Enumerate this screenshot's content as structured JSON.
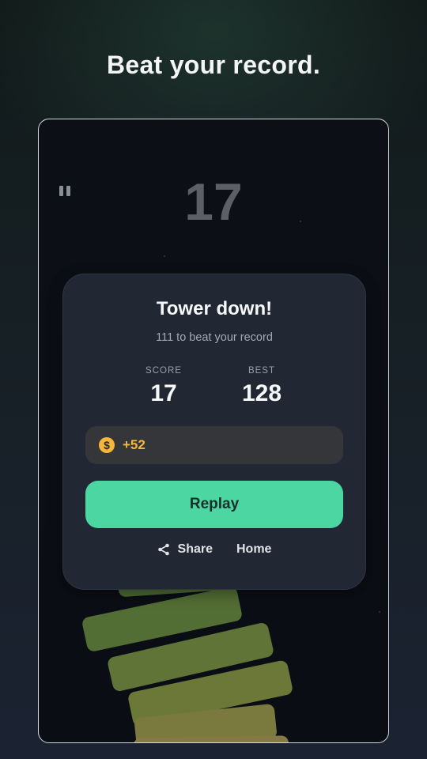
{
  "headline": "Beat your record.",
  "game": {
    "current_score": "17",
    "pause_icon": "pause-icon"
  },
  "dialog": {
    "title": "Tower down!",
    "subtitle": "111 to beat your record",
    "score_label": "SCORE",
    "score_value": "17",
    "best_label": "BEST",
    "best_value": "128",
    "coin_icon": "dollar-coin-icon",
    "coins_earned": "+52",
    "replay_label": "Replay",
    "share_label": "Share",
    "share_icon": "share-icon",
    "home_label": "Home"
  },
  "colors": {
    "accent": "#4cd6a1",
    "coin": "#f3b73a",
    "dialog_bg": "#222833"
  }
}
